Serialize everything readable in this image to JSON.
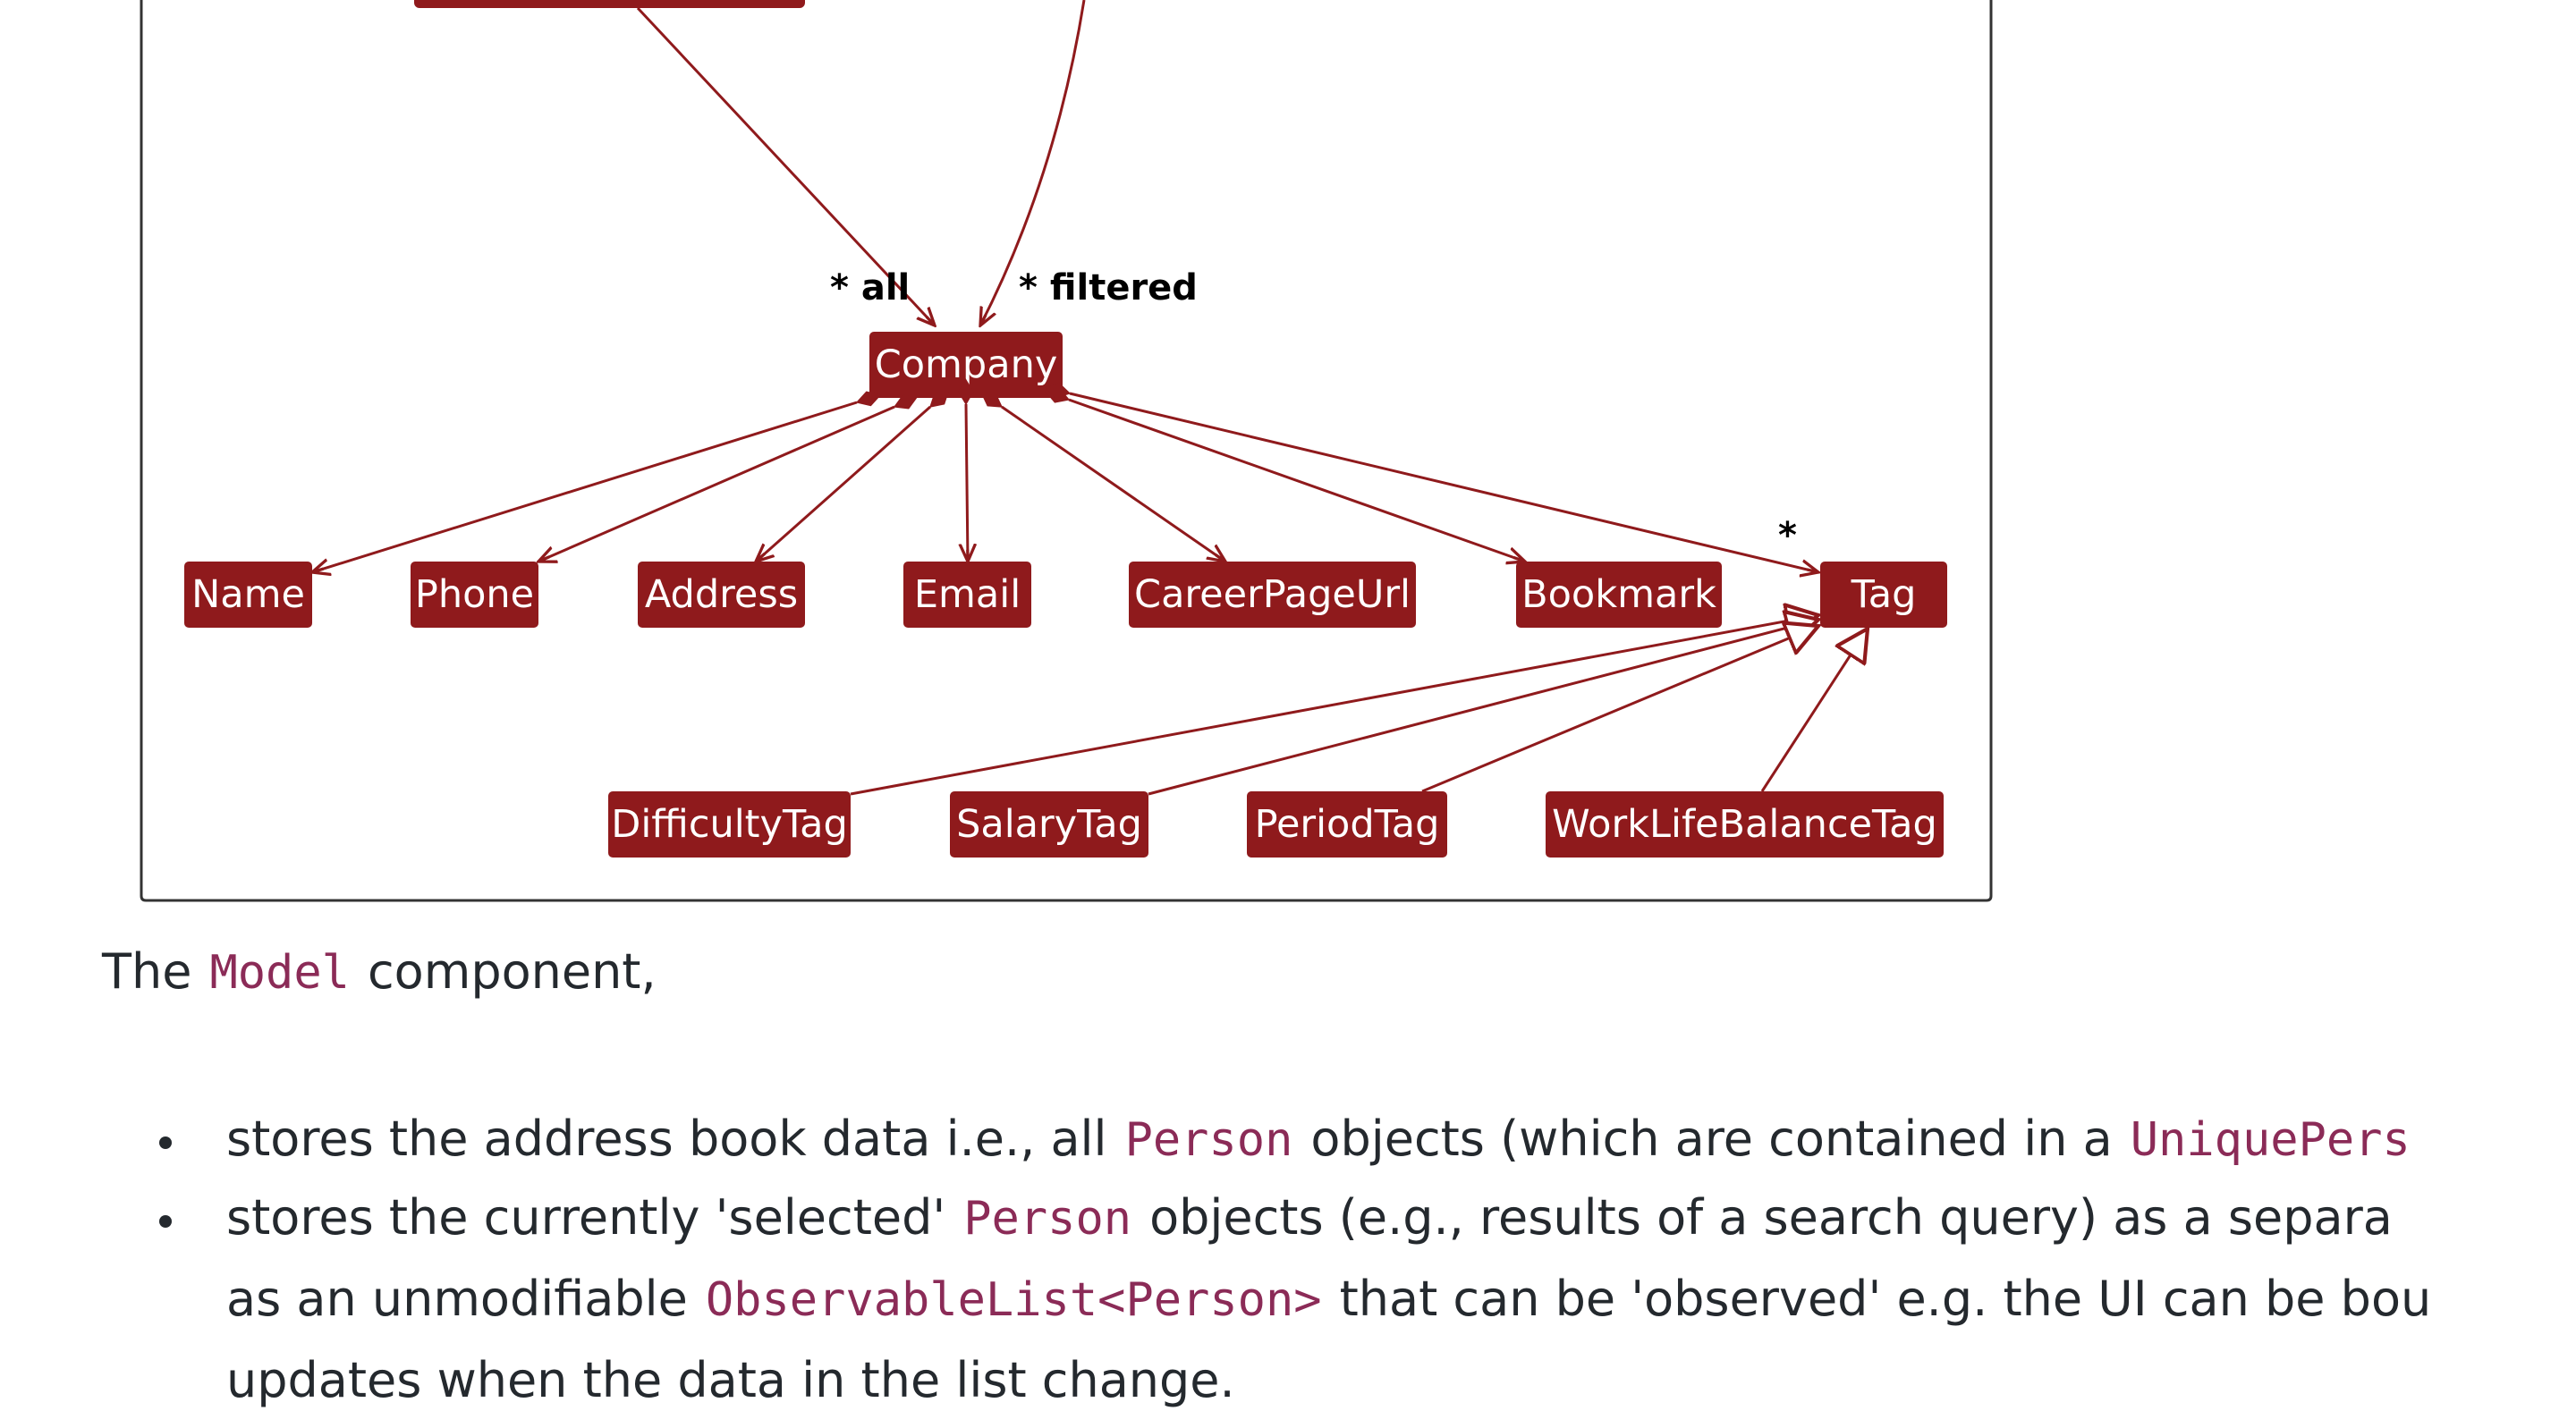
{
  "diagram": {
    "accent_color": "#8f1a1c",
    "frame_color": "#333333",
    "company": {
      "label": "Company"
    },
    "association_labels": {
      "all": "* all",
      "filtered": "* filtered",
      "tag_multiplicity": "*"
    },
    "attributes": [
      {
        "id": "name",
        "label": "Name"
      },
      {
        "id": "phone",
        "label": "Phone"
      },
      {
        "id": "address",
        "label": "Address"
      },
      {
        "id": "email",
        "label": "Email"
      },
      {
        "id": "careerpageurl",
        "label": "CareerPageUrl"
      },
      {
        "id": "bookmark",
        "label": "Bookmark"
      },
      {
        "id": "tag",
        "label": "Tag"
      }
    ],
    "tag_subclasses": [
      {
        "id": "difficultytag",
        "label": "DifficultyTag"
      },
      {
        "id": "salarytag",
        "label": "SalaryTag"
      },
      {
        "id": "periodtag",
        "label": "PeriodTag"
      },
      {
        "id": "worklifebalancetag",
        "label": "WorkLifeBalanceTag"
      }
    ]
  },
  "text": {
    "intro": {
      "before": "The",
      "code": "Model",
      "after": "component,"
    },
    "bullets": [
      {
        "lines": [
          {
            "before": "stores the address book data i.e., all",
            "code": "Person",
            "after": "objects (which are contained in a",
            "code2": "UniquePers"
          }
        ]
      },
      {
        "lines": [
          {
            "before": "stores the currently 'selected'",
            "code": "Person",
            "after": "objects (e.g., results of a search query) as a separa"
          },
          {
            "before": "as an unmodifiable",
            "code": "ObservableList<Person>",
            "after": "that can be 'observed' e.g. the UI can be bou"
          },
          {
            "before": "updates when the data in the list change."
          }
        ]
      }
    ],
    "code_color": "#8b2b57",
    "text_color": "#24292e"
  }
}
